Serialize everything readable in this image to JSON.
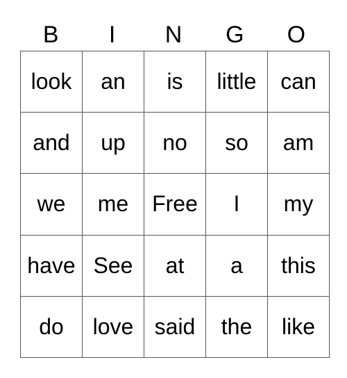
{
  "header": {
    "letters": [
      "B",
      "I",
      "N",
      "G",
      "O"
    ]
  },
  "card": {
    "rows": [
      [
        "look",
        "an",
        "is",
        "little",
        "can"
      ],
      [
        "and",
        "up",
        "no",
        "so",
        "am"
      ],
      [
        "we",
        "me",
        "Free",
        "I",
        "my"
      ],
      [
        "have",
        "See",
        "at",
        "a",
        "this"
      ],
      [
        "do",
        "love",
        "said",
        "the",
        "like"
      ]
    ]
  },
  "colors": {
    "grid_line": "#555555",
    "text": "#000000",
    "background": "#ffffff"
  }
}
